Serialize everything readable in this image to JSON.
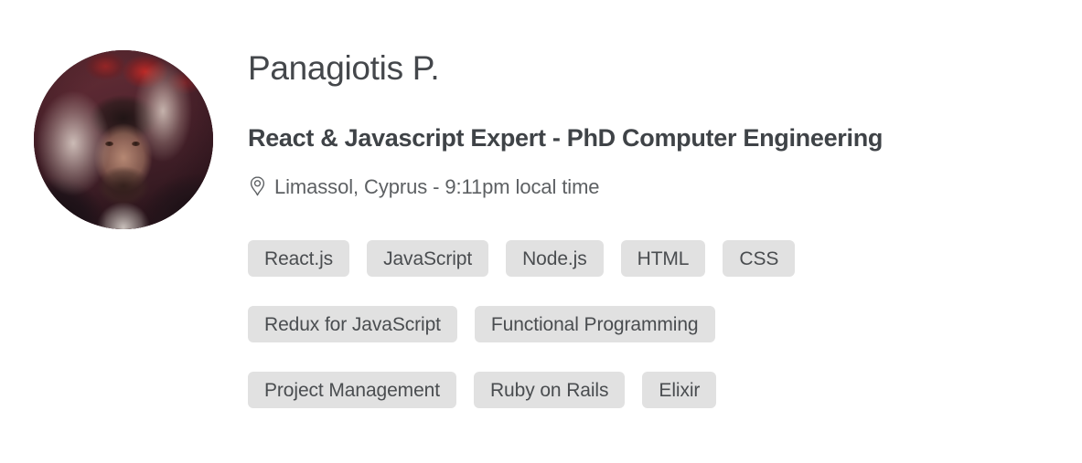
{
  "profile": {
    "name": "Panagiotis P.",
    "headline": "React & Javascript Expert - PhD Computer Engineering",
    "location": {
      "icon": "map-pin-icon",
      "text": "Limassol, Cyprus - 9:11pm local time",
      "city": "Limassol",
      "country": "Cyprus",
      "local_time": "9:11pm"
    },
    "avatar": {
      "alt": "Profile photo of Panagiotis P.",
      "shape": "circle"
    },
    "skill_rows": [
      [
        "React.js",
        "JavaScript",
        "Node.js",
        "HTML",
        "CSS"
      ],
      [
        "Redux for JavaScript",
        "Functional Programming"
      ],
      [
        "Project Management",
        "Ruby on Rails",
        "Elixir"
      ]
    ]
  },
  "colors": {
    "page_background": "#ffffff",
    "name_text": "#44474b",
    "headline_text": "#3f4347",
    "location_text": "#5d6063",
    "tag_background": "#e1e1e1",
    "tag_text": "#4a4d50"
  }
}
